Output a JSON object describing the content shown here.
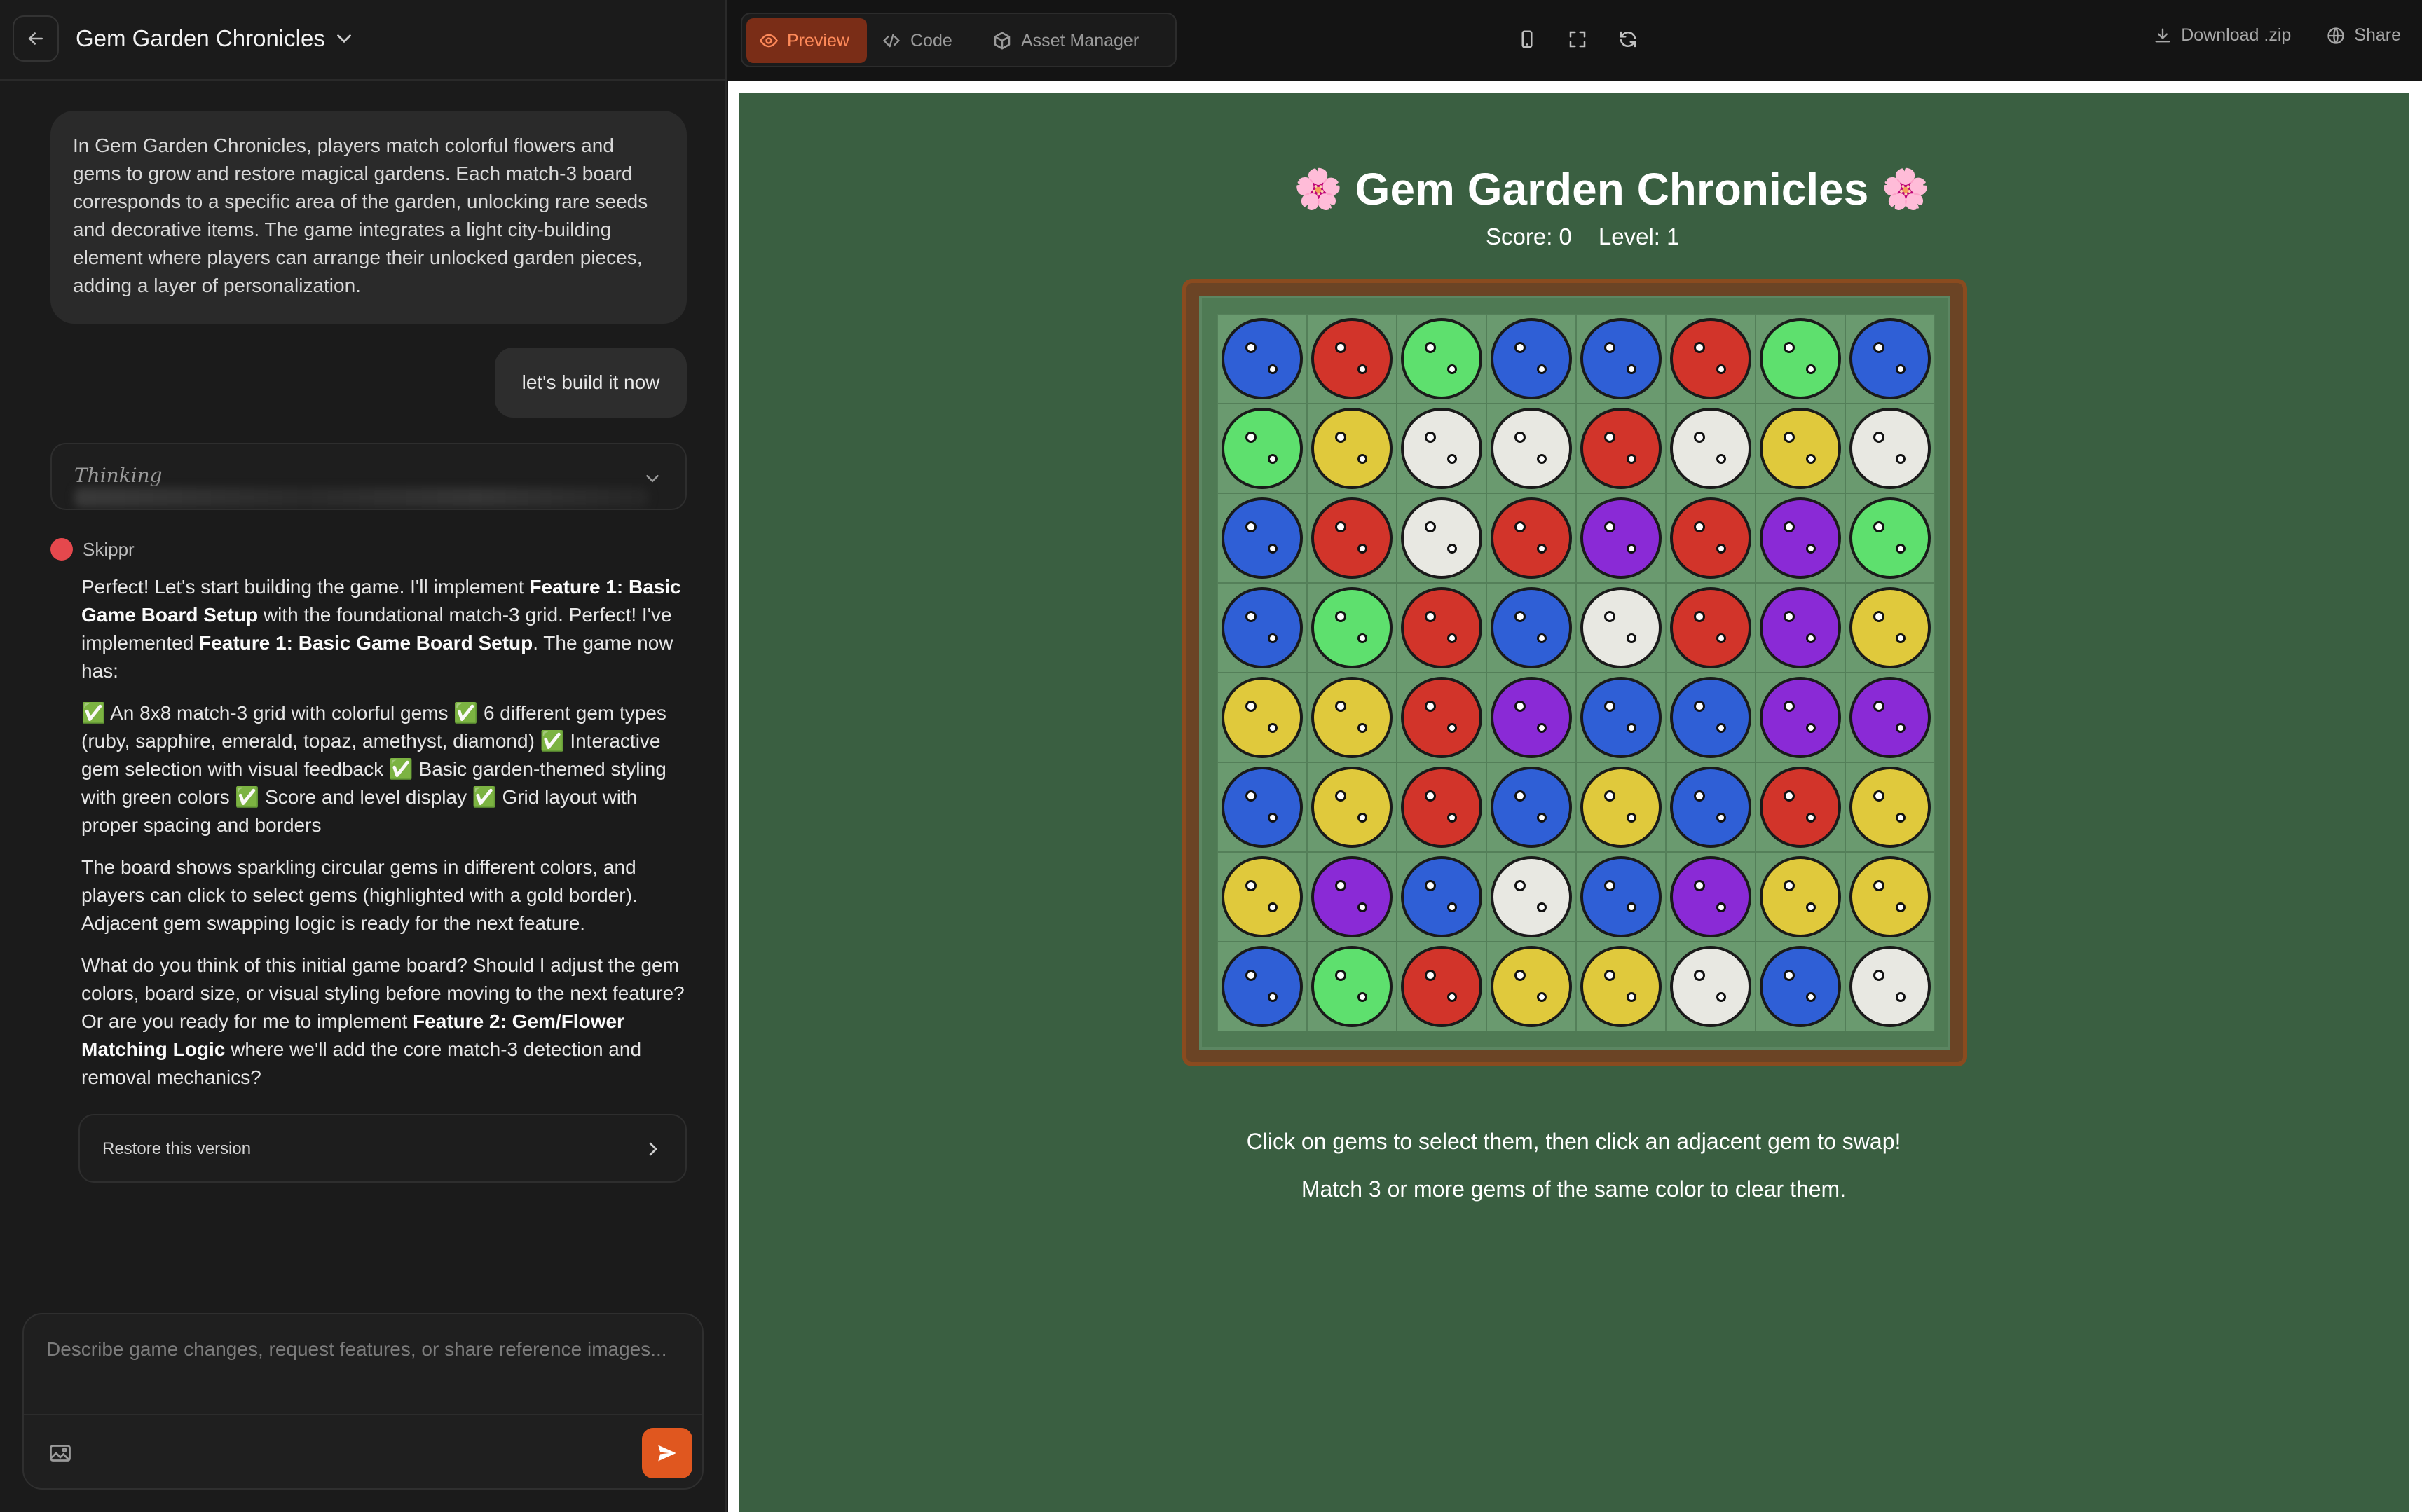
{
  "project": {
    "title": "Gem Garden Chronicles"
  },
  "chat": {
    "ai_intro": "In Gem Garden Chronicles, players match colorful flowers and gems to grow and restore magical gardens. Each match-3 board corresponds to a specific area of the garden, unlocking rare seeds and decorative items. The game integrates a light city-building element where players can arrange their unlocked garden pieces, adding a layer of personalization.",
    "user_msg": "let's build it now",
    "thinking_label": "Thinking",
    "assistant_name": "Skippr",
    "msg": {
      "p1_a": "Perfect! Let's start building the game. I'll implement ",
      "p1_b": "Feature 1: Basic Game Board Setup",
      "p1_c": " with the foundational match-3 grid. Perfect! I've implemented ",
      "p1_d": "Feature 1: Basic Game Board Setup",
      "p1_e": ". The game now has:",
      "p2": "✅ An 8x8 match-3 grid with colorful gems ✅ 6 different gem types (ruby, sapphire, emerald, topaz, amethyst, diamond) ✅ Interactive gem selection with visual feedback ✅ Basic garden-themed styling with green colors ✅ Score and level display ✅ Grid layout with proper spacing and borders",
      "p3": "The board shows sparkling circular gems in different colors, and players can click to select gems (highlighted with a gold border). Adjacent gem swapping logic is ready for the next feature.",
      "p4_a": "What do you think of this initial game board? Should I adjust the gem colors, board size, or visual styling before moving to the next feature? Or are you ready for me to implement ",
      "p4_b": "Feature 2: Gem/Flower Matching Logic",
      "p4_c": " where we'll add the core match-3 detection and removal mechanics?"
    },
    "restore_label": "Restore this version",
    "composer_placeholder": "Describe game changes, request features, or share reference images..."
  },
  "toolbar": {
    "tabs": [
      "Preview",
      "Code",
      "Asset Manager"
    ],
    "active_tab": "Preview",
    "download_label": "Download .zip",
    "share_label": "Share"
  },
  "game": {
    "title": "Gem Garden Chronicles",
    "title_emoji": "🌸",
    "score_text": "Score: 0",
    "level_text": "Level: 1",
    "instruction_1": "Click on gems to select them, then click an adjacent gem to swap!",
    "instruction_2": "Match 3 or more gems of the same color to clear them.",
    "colors": {
      "B": "#2f5fd6",
      "R": "#d2342a",
      "G": "#5ee06e",
      "Y": "#e0c93c",
      "W": "#e8e8e2",
      "P": "#8a2ad6"
    },
    "board": [
      [
        "B",
        "R",
        "G",
        "B",
        "B",
        "R",
        "G",
        "B"
      ],
      [
        "G",
        "Y",
        "W",
        "W",
        "R",
        "W",
        "Y",
        "W"
      ],
      [
        "B",
        "R",
        "W",
        "R",
        "P",
        "R",
        "P",
        "G"
      ],
      [
        "B",
        "G",
        "R",
        "B",
        "W",
        "R",
        "P",
        "Y"
      ],
      [
        "Y",
        "Y",
        "R",
        "P",
        "B",
        "B",
        "P",
        "P"
      ],
      [
        "B",
        "Y",
        "R",
        "B",
        "Y",
        "B",
        "R",
        "Y"
      ],
      [
        "Y",
        "P",
        "B",
        "W",
        "B",
        "P",
        "Y",
        "Y"
      ],
      [
        "B",
        "G",
        "R",
        "Y",
        "Y",
        "W",
        "B",
        "W"
      ]
    ]
  }
}
